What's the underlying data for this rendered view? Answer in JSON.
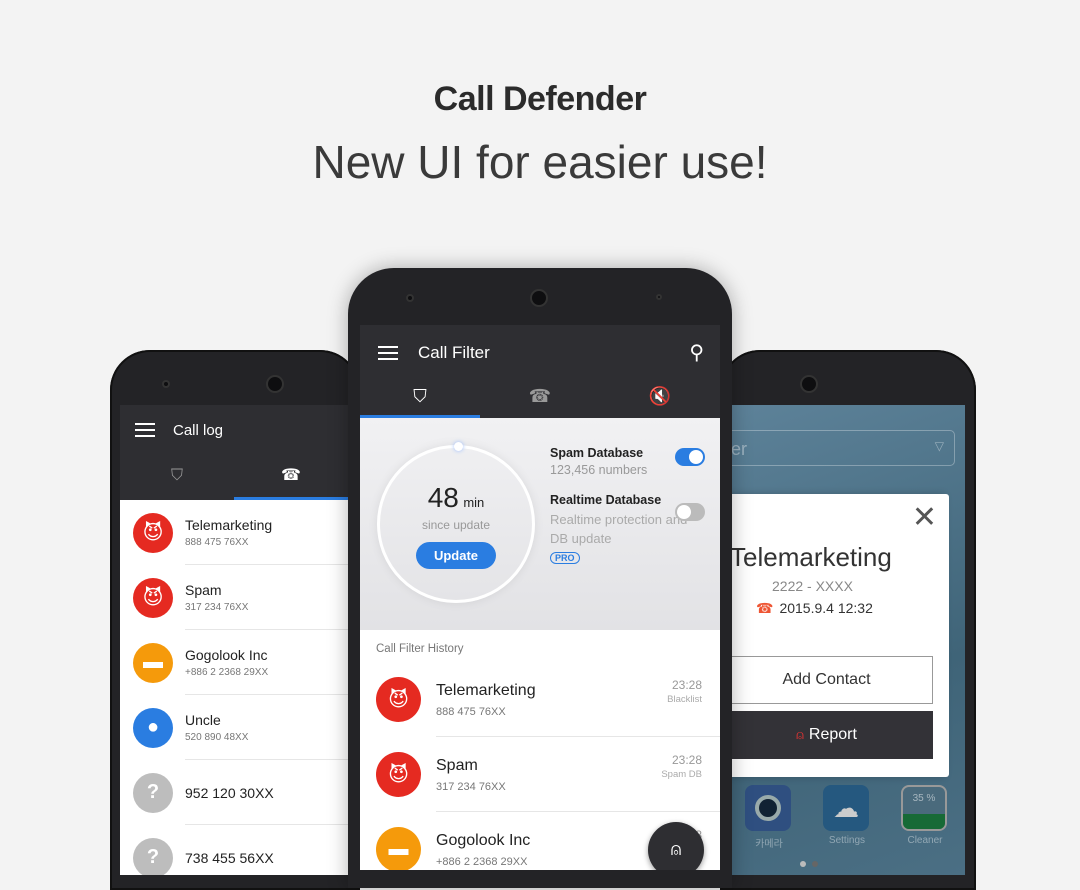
{
  "headline": {
    "title": "Call Defender",
    "subtitle": "New UI for easier use!"
  },
  "left_phone": {
    "title": "Call log",
    "tabs": [
      "shield-icon",
      "phone-icon"
    ],
    "active_tab": 1,
    "items": [
      {
        "name": "Telemarketing",
        "number": "888 475 76XX",
        "icon": "devil-icon",
        "color": "#e52a21"
      },
      {
        "name": "Spam",
        "number": "317 234 76XX",
        "icon": "devil-icon",
        "color": "#e52a21"
      },
      {
        "name": "Gogolook Inc",
        "number": "+886 2 2368 29XX",
        "icon": "store-icon",
        "color": "#f59a0b"
      },
      {
        "name": "Uncle",
        "number": "520 890 48XX",
        "icon": "person-icon",
        "color": "#2a7de1"
      },
      {
        "name": "952 120 30XX",
        "number": "",
        "icon": "unknown-icon",
        "color": "#bdbdbd"
      },
      {
        "name": "738 455 56XX",
        "number": "",
        "icon": "unknown-icon",
        "color": "#bdbdbd"
      }
    ]
  },
  "center_phone": {
    "title": "Call Filter",
    "tabs": [
      "shield-icon",
      "phone-icon",
      "mute-icon"
    ],
    "active_tab": 0,
    "timer": {
      "value": "48",
      "unit": "min",
      "label": "since update",
      "button": "Update"
    },
    "settings": [
      {
        "title": "Spam Database",
        "desc": "123,456 numbers",
        "on": true
      },
      {
        "title": "Realtime Database",
        "desc": "Realtime protection and DB update",
        "on": false,
        "badge": "PRO"
      }
    ],
    "history_label": "Call Filter History",
    "history": [
      {
        "name": "Telemarketing",
        "number": "888 475 76XX",
        "time": "23:28",
        "source": "Blacklist",
        "icon": "devil-icon"
      },
      {
        "name": "Spam",
        "number": "317 234 76XX",
        "time": "23:28",
        "source": "Spam DB",
        "icon": "devil-icon"
      },
      {
        "name": "Gogolook Inc",
        "number": "+886 2 2368 29XX",
        "time": "23:28",
        "source": "",
        "icon": "store-icon"
      }
    ]
  },
  "right_phone": {
    "search_partial": "er",
    "dialog": {
      "name": "Telemarketing",
      "number": "2222 - XXXX",
      "datetime": "2015.9.4 12:32",
      "add_contact": "Add Contact",
      "report": "Report"
    },
    "apps": [
      {
        "label": "카메라"
      },
      {
        "label": "Settings"
      },
      {
        "label": "Cleaner",
        "value": "35 %"
      }
    ]
  },
  "colors": {
    "accent": "#2a7de1",
    "danger": "#e52a21",
    "dark": "#2e2e32"
  }
}
